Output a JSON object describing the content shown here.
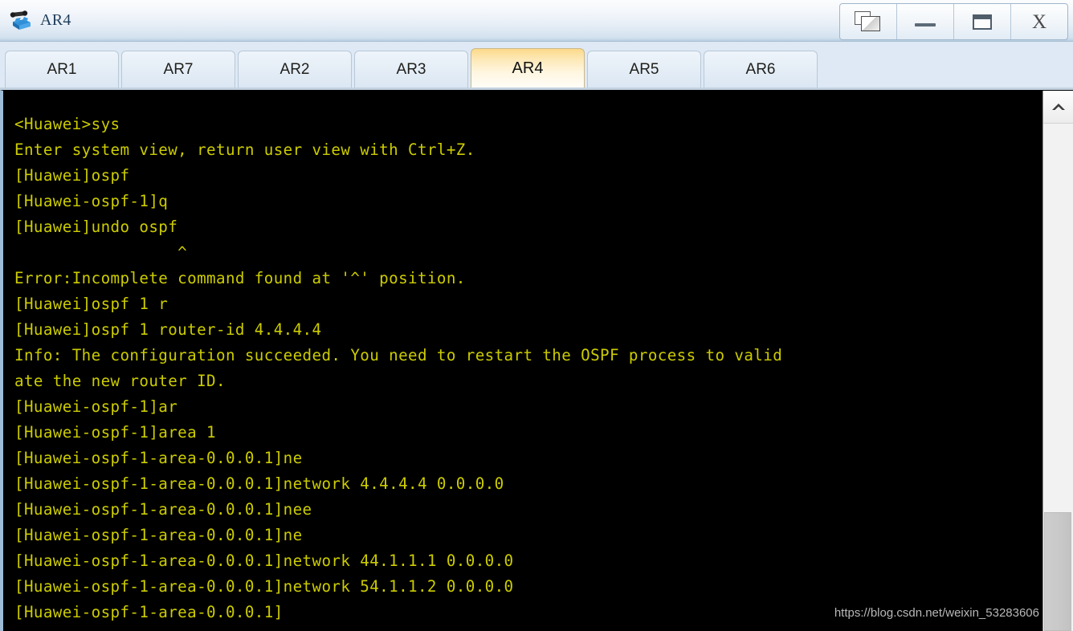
{
  "window": {
    "title": "AR4",
    "icon": "router-device-icon",
    "controls": [
      {
        "name": "cascade-windows-button",
        "icon": "cascade-windows-icon",
        "label": ""
      },
      {
        "name": "minimize-button",
        "icon": "minimize-icon",
        "label": ""
      },
      {
        "name": "maximize-button",
        "icon": "maximize-icon",
        "label": ""
      },
      {
        "name": "close-button",
        "icon": "close-icon",
        "label": "X"
      }
    ]
  },
  "tabs": {
    "active": "AR4",
    "items": [
      {
        "label": "AR1"
      },
      {
        "label": "AR7"
      },
      {
        "label": "AR2"
      },
      {
        "label": "AR3"
      },
      {
        "label": "AR4"
      },
      {
        "label": "AR5"
      },
      {
        "label": "AR6"
      }
    ]
  },
  "terminal": {
    "foreground": "#cccc00",
    "background": "#000000",
    "lines": [
      "<Huawei>sys",
      "Enter system view, return user view with Ctrl+Z.",
      "[Huawei]ospf",
      "[Huawei-ospf-1]q",
      "[Huawei]undo ospf",
      "                 ^",
      "Error:Incomplete command found at '^' position.",
      "[Huawei]ospf 1 r",
      "[Huawei]ospf 1 router-id 4.4.4.4",
      "Info: The configuration succeeded. You need to restart the OSPF process to valid",
      "ate the new router ID.",
      "[Huawei-ospf-1]ar",
      "[Huawei-ospf-1]area 1",
      "[Huawei-ospf-1-area-0.0.0.1]ne",
      "[Huawei-ospf-1-area-0.0.0.1]network 4.4.4.4 0.0.0.0",
      "[Huawei-ospf-1-area-0.0.0.1]nee",
      "[Huawei-ospf-1-area-0.0.0.1]ne",
      "[Huawei-ospf-1-area-0.0.0.1]network 44.1.1.1 0.0.0.0",
      "[Huawei-ospf-1-area-0.0.0.1]network 54.1.1.2 0.0.0.0",
      "[Huawei-ospf-1-area-0.0.0.1]"
    ],
    "text": "<Huawei>sys\nEnter system view, return user view with Ctrl+Z.\n[Huawei]ospf\n[Huawei-ospf-1]q\n[Huawei]undo ospf\n                 ^\nError:Incomplete command found at '^' position.\n[Huawei]ospf 1 r\n[Huawei]ospf 1 router-id 4.4.4.4\nInfo: The configuration succeeded. You need to restart the OSPF process to valid\nate the new router ID.\n[Huawei-ospf-1]ar\n[Huawei-ospf-1]area 1\n[Huawei-ospf-1-area-0.0.0.1]ne\n[Huawei-ospf-1-area-0.0.0.1]network 4.4.4.4 0.0.0.0\n[Huawei-ospf-1-area-0.0.0.1]nee\n[Huawei-ospf-1-area-0.0.0.1]ne\n[Huawei-ospf-1-area-0.0.0.1]network 44.1.1.1 0.0.0.0\n[Huawei-ospf-1-area-0.0.0.1]network 54.1.1.2 0.0.0.0\n[Huawei-ospf-1-area-0.0.0.1]"
  },
  "scrollbar": {
    "up_arrow_icon": "chevron-up-icon"
  },
  "watermark": {
    "text": "https://blog.csdn.net/weixin_53283606"
  }
}
